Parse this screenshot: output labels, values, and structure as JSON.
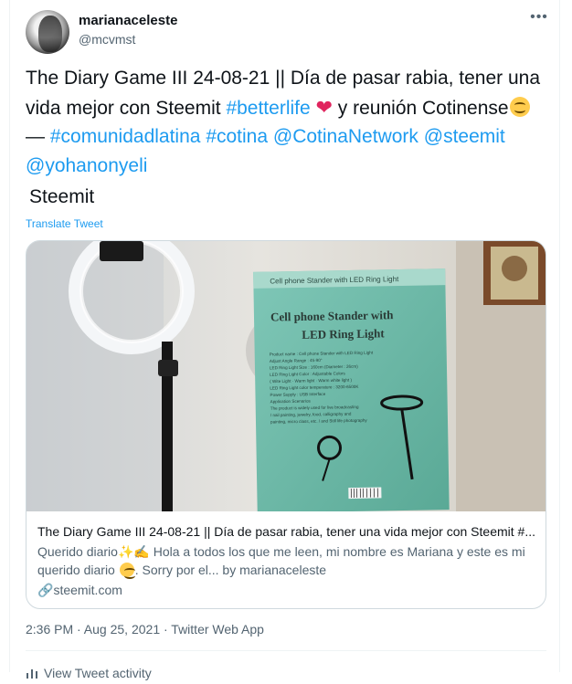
{
  "author": {
    "display_name": "marianaceleste",
    "handle": "@mcvmst"
  },
  "more_icon": "•••",
  "tweet": {
    "text_1": "The Diary Game III 24-08-21 || Día de pasar rabia, tener una vida mejor con Steemit ",
    "hashtag_betterlife": "#betterlife",
    "text_2": " y reunión Cotinense",
    "text_3": " — ",
    "hashtag_comunidadlatina": "#comunidadlatina",
    "hashtag_cotina": "#cotina",
    "mention_cotinanetwork": "@CotinaNetwork",
    "mention_steemit": "@steemit",
    "mention_yohanonyeli": "@yohanonyeli",
    "source_line": " Steemit",
    "translate": "Translate Tweet"
  },
  "card": {
    "image_text_title": "Cell phone Stander with",
    "image_text_title2": "LED Ring Light",
    "image_box_edge": "Cell phone Stander with LED Ring Light",
    "image_specs": [
      "Product name : Cell phone Stander with LED Ring Light",
      "Adjust Angle Range : 45-90°",
      "LED Ring Light Size : 160cm (Diameter : 26cm)",
      "LED Ring Light Color : Adjustable Colors",
      "( Wite Light · Warm light · Warm white light )",
      "LED Ring Light color temperature : 3200-6500K",
      "Power Supply : USB Interface",
      "Application Scenarios",
      "The product is widely used for live broadcasting",
      "/ nail painting, jewelry, food, calligraphy and",
      "painting, micro class, etc. / and Still life photography"
    ],
    "title": "The Diary Game III 24-08-21 || Día de pasar rabia, tener una vida mejor con Steemit #...",
    "desc_1": "Querido diario",
    "desc_2": " Hola a todos los que me leen, mi nombre es Mariana y este es mi querido diario",
    "desc_3": ". Sorry por el... by marianaceleste",
    "domain": "steemit.com"
  },
  "timestamp": "2:36 PM · Aug 25, 2021 · Twitter Web App",
  "bottom_partial": "View Tweet activity",
  "colors": {
    "link": "#1d9bf0",
    "secondary": "#536471",
    "border": "#cfd9de",
    "heart": "#e0245e"
  },
  "icons": [
    "more-icon",
    "heart-emoji-icon",
    "smile-emoji-icon",
    "sparkles-emoji-icon",
    "writing-hand-emoji-icon",
    "link-icon",
    "chart-icon"
  ]
}
